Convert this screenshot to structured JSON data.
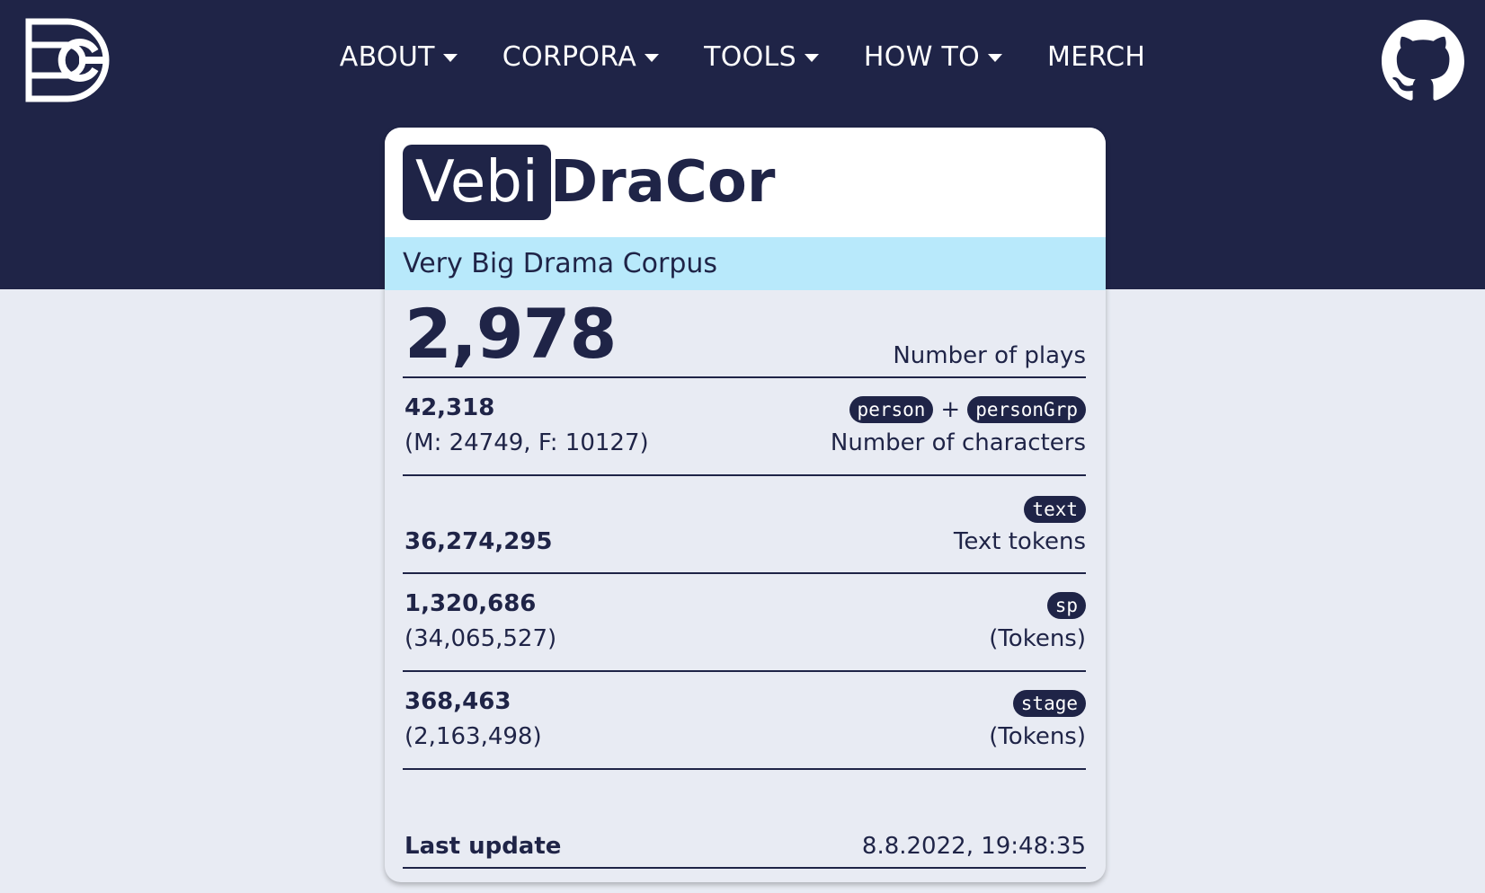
{
  "nav": {
    "items": [
      {
        "label": "ABOUT",
        "dropdown": true
      },
      {
        "label": "CORPORA",
        "dropdown": true
      },
      {
        "label": "TOOLS",
        "dropdown": true
      },
      {
        "label": "HOW TO",
        "dropdown": true
      },
      {
        "label": "MERCH",
        "dropdown": false
      }
    ]
  },
  "icons": {
    "logo": "dracor-logo-icon",
    "github": "github-icon"
  },
  "colors": {
    "primary": "#1f2447",
    "subtitle_bg": "#b8e9fb",
    "page_bg": "#e8ebf3"
  },
  "card": {
    "title_box": "Vebi",
    "title_rest": "DraCor",
    "subtitle": "Very Big Drama Corpus",
    "plays": {
      "value": "2,978",
      "label": "Number of plays"
    },
    "characters": {
      "value": "42,318",
      "sub": "(M: 24749, F: 10127)",
      "tag1": "person",
      "plus": "+",
      "tag2": "personGrp",
      "label": "Number of characters"
    },
    "text_tokens": {
      "value": "36,274,295",
      "tag": "text",
      "label": "Text tokens"
    },
    "sp": {
      "value": "1,320,686",
      "sub": "(34,065,527)",
      "tag": "sp",
      "label": "(Tokens)"
    },
    "stage": {
      "value": "368,463",
      "sub": "(2,163,498)",
      "tag": "stage",
      "label": "(Tokens)"
    },
    "last_update": {
      "label": "Last update",
      "value": "8.8.2022, 19:48:35"
    }
  }
}
